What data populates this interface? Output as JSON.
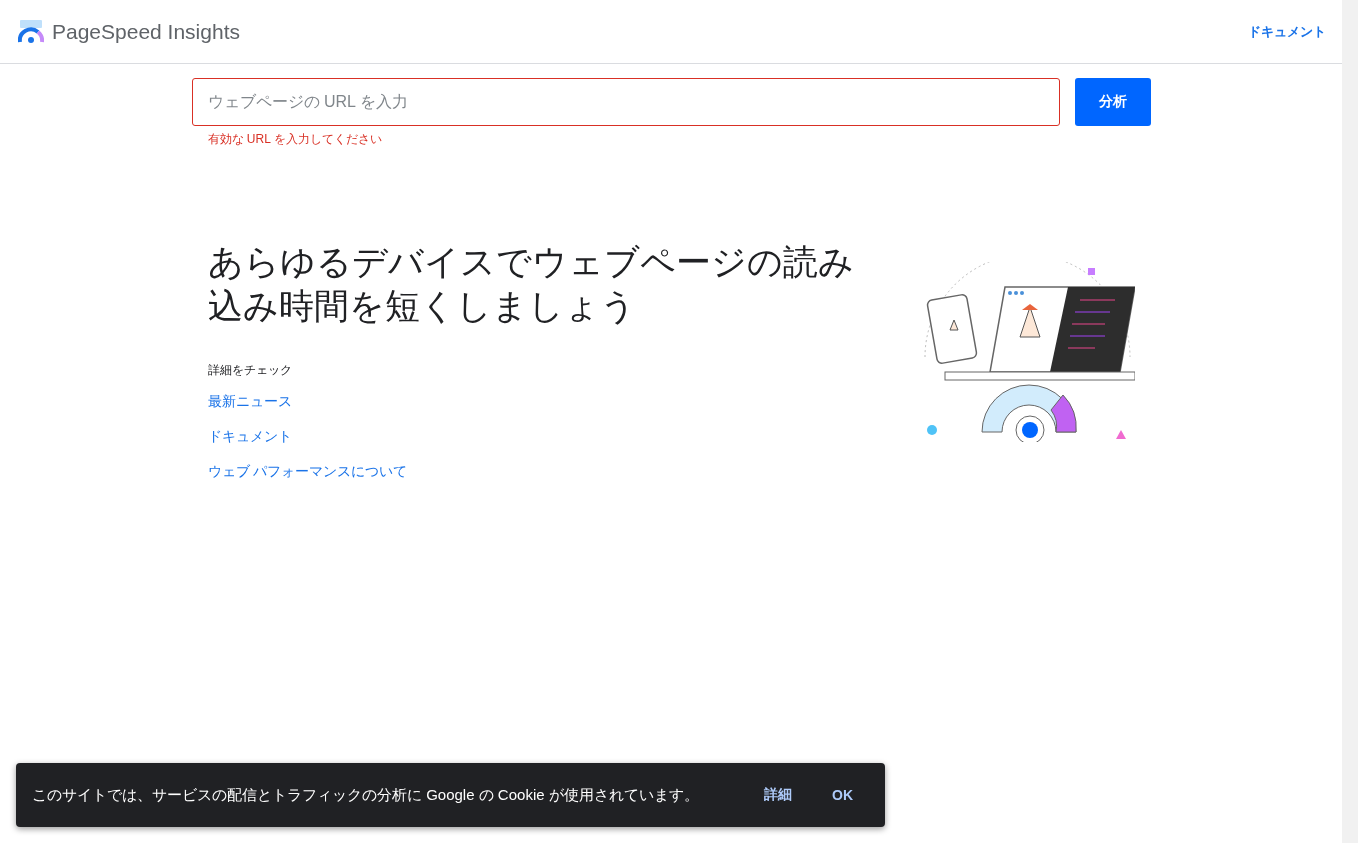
{
  "header": {
    "title": "PageSpeed Insights",
    "nav_link": "ドキュメント"
  },
  "search": {
    "placeholder": "ウェブページの URL を入力",
    "error": "有効な URL を入力してください",
    "button": "分析",
    "invalid": true
  },
  "hero": {
    "heading": "あらゆるデバイスでウェブページの読み込み時間を短くしましょう",
    "links_label": "詳細をチェック",
    "links": [
      "最新ニュース",
      "ドキュメント",
      "ウェブ パフォーマンスについて"
    ]
  },
  "cookie_bar": {
    "message": "このサイトでは、サービスの配信とトラフィックの分析に Google の Cookie が使用されています。",
    "buttons": [
      "詳細",
      "OK"
    ]
  }
}
